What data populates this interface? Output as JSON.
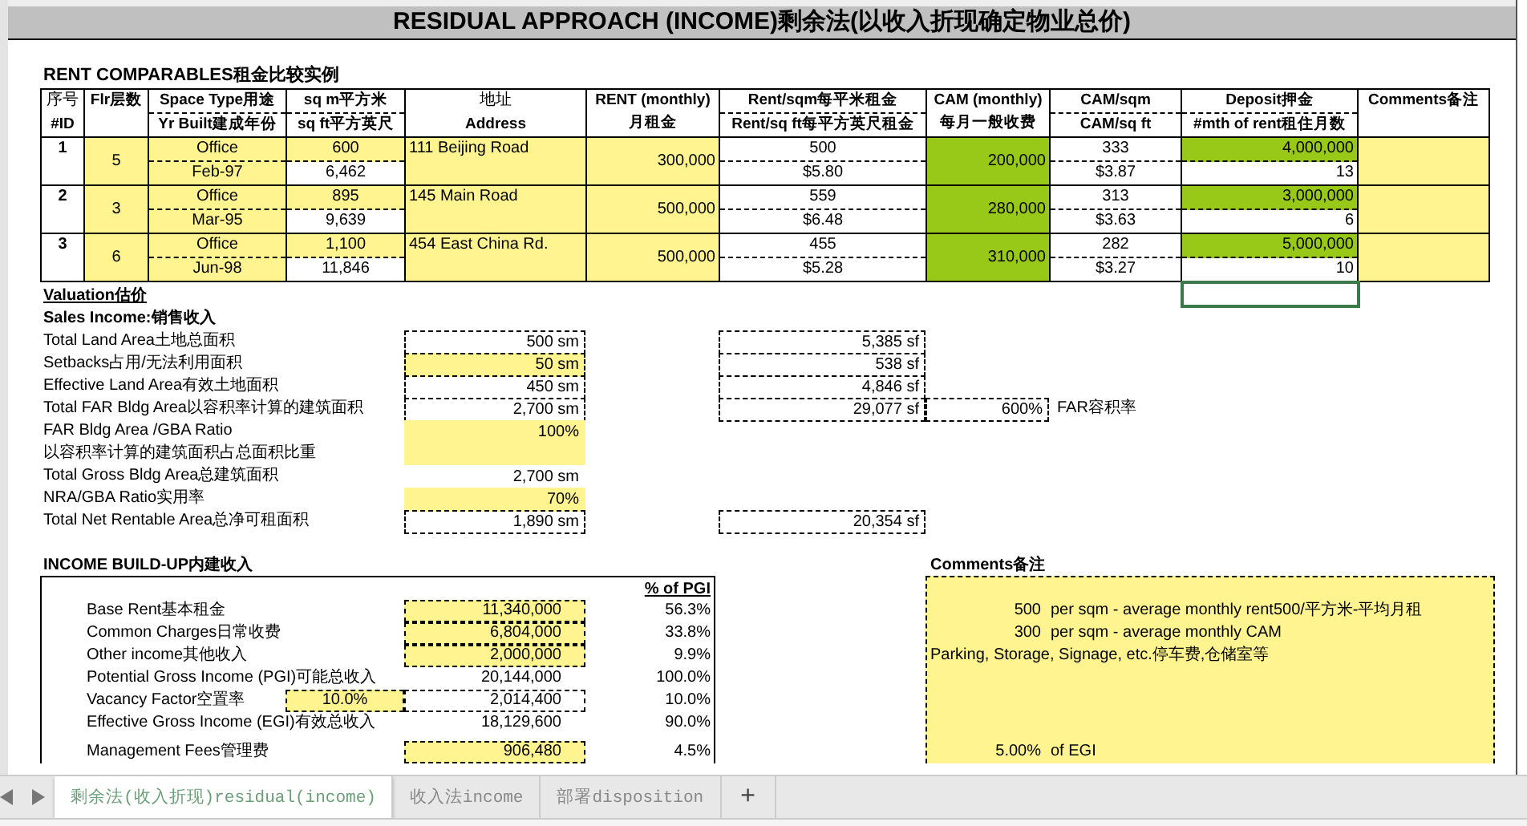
{
  "title": "RESIDUAL APPROACH (INCOME)剩余法(以收入折现确定物业总价)",
  "rent_comparables": {
    "heading": "RENT COMPARABLES租金比较实例",
    "columns": [
      {
        "kind": "stacked",
        "texts": [
          "序号",
          "#ID"
        ]
      },
      {
        "kind": "single",
        "texts": [
          "Flr层数"
        ]
      },
      {
        "kind": "split",
        "texts": [
          "Space Type用途",
          "Yr Built建成年份"
        ]
      },
      {
        "kind": "split",
        "texts": [
          "sq m平方米",
          "sq ft平方英尺"
        ]
      },
      {
        "kind": "stacked",
        "texts": [
          "地址",
          "Address"
        ]
      },
      {
        "kind": "single",
        "texts": [
          "RENT (monthly)月租金"
        ]
      },
      {
        "kind": "split",
        "texts": [
          "Rent/sqm每平米租金",
          "Rent/sq ft每平方英尺租金"
        ]
      },
      {
        "kind": "single",
        "texts": [
          "CAM (monthly)每月一般收费"
        ]
      },
      {
        "kind": "split",
        "texts": [
          "CAM/sqm",
          "CAM/sq ft"
        ]
      },
      {
        "kind": "split",
        "texts": [
          "Deposit押金",
          "#mth of rent租住月数"
        ]
      },
      {
        "kind": "single",
        "texts": [
          "Comments备注"
        ]
      }
    ],
    "rows": [
      {
        "id": "1",
        "floors": "5",
        "space_type": "Office",
        "yr_built": "Feb-97",
        "sqm": "600",
        "sqft": "6,462",
        "address": "111 Beijing Road",
        "rent": "300,000",
        "rent_sqm": "500",
        "rent_sqft": "$5.80",
        "cam": "200,000",
        "cam_sqm": "333",
        "cam_sqft": "$3.87",
        "deposit": "4,000,000",
        "deposit_months": "13"
      },
      {
        "id": "2",
        "floors": "3",
        "space_type": "Office",
        "yr_built": "Mar-95",
        "sqm": "895",
        "sqft": "9,639",
        "address": "145 Main Road",
        "rent": "500,000",
        "rent_sqm": "559",
        "rent_sqft": "$6.48",
        "cam": "280,000",
        "cam_sqm": "313",
        "cam_sqft": "$3.63",
        "deposit": "3,000,000",
        "deposit_months": "6"
      },
      {
        "id": "3",
        "floors": "6",
        "space_type": "Office",
        "yr_built": "Jun-98",
        "sqm": "1,100",
        "sqft": "11,846",
        "address": "454 East China Rd.",
        "rent": "500,000",
        "rent_sqm": "455",
        "rent_sqft": "$5.28",
        "cam": "310,000",
        "cam_sqm": "282",
        "cam_sqft": "$3.27",
        "deposit": "5,000,000",
        "deposit_months": "10"
      }
    ]
  },
  "valuation": {
    "heading": "Valuation估价",
    "subheading": "Sales Income:销售收入",
    "rows": [
      {
        "label": "Total Land Area土地总面积",
        "sm": "500 sm",
        "sm_highlight": false,
        "sm_outlined": true,
        "sf": "5,385 sf"
      },
      {
        "label": "Setbacks占用/无法利用面积",
        "sm": "50 sm",
        "sm_highlight": true,
        "sm_outlined": true,
        "sf": "538 sf"
      },
      {
        "label": "Effective Land Area有效土地面积",
        "sm": "450 sm",
        "sm_highlight": false,
        "sm_outlined": true,
        "sf": "4,846 sf"
      },
      {
        "label": "Total FAR Bldg Area以容积率计算的建筑面积",
        "sm": "2,700 sm",
        "sm_highlight": false,
        "sm_outlined": true,
        "sf": "29,077 sf",
        "far": "600%",
        "far_label": "FAR容积率"
      },
      {
        "label": "FAR Bldg Area /GBA Ratio",
        "sm": "100%",
        "sm_highlight": true,
        "sm_outlined": false
      },
      {
        "label": "以容积率计算的建筑面积占总面积比重",
        "sm_highlight": true,
        "sm_outlined": false
      },
      {
        "label": "Total Gross Bldg Area总建筑面积",
        "sm": "2,700 sm",
        "sm_highlight": false,
        "sm_outlined": false
      },
      {
        "label": "NRA/GBA Ratio实用率",
        "sm": "70%",
        "sm_highlight": true,
        "sm_outlined": false
      },
      {
        "label": "Total Net Rentable Area总净可租面积",
        "sm": "1,890 sm",
        "sm_highlight": false,
        "sm_outlined": true,
        "sf": "20,354 sf"
      }
    ]
  },
  "income": {
    "heading": "INCOME BUILD-UP内建收入",
    "pct_heading": "% of PGI",
    "comments_heading": "Comments备注",
    "rows": [
      {
        "kind": "line",
        "label": "Base Rent基本租金",
        "value": "11,340,000",
        "highlight": true,
        "outlined": true,
        "pct": "56.3%",
        "comment_amount": "500",
        "comment_text": "per sqm - average monthly rent500/平方米-平均月租"
      },
      {
        "kind": "line",
        "label": "Common Charges日常收费",
        "value": "6,804,000",
        "highlight": true,
        "outlined": true,
        "pct": "33.8%",
        "comment_amount": "300",
        "comment_text": "per sqm - average monthly CAM"
      },
      {
        "kind": "line",
        "label": "Other income其他收入",
        "value": "2,000,000",
        "highlight": true,
        "outlined": true,
        "pct": "9.9%",
        "comment_text": "Parking, Storage, Signage, etc.停车费,仓储室等"
      },
      {
        "kind": "line",
        "label": "Potential Gross Income (PGI)可能总收入",
        "value": "20,144,000",
        "highlight": false,
        "outlined": false,
        "pct": "100.0%"
      },
      {
        "kind": "line",
        "label": "Vacancy Factor空置率",
        "input": "10.0%",
        "value": "2,014,400",
        "highlight": false,
        "outlined": true,
        "pct": "10.0%"
      },
      {
        "kind": "line",
        "label": "Effective Gross Income (EGI)有效总收入",
        "value": "18,129,600",
        "highlight": false,
        "outlined": false,
        "pct": "90.0%"
      },
      {
        "kind": "blank"
      },
      {
        "kind": "line",
        "label": "Management Fees管理费",
        "value": "906,480",
        "highlight": true,
        "outlined": true,
        "pct": "4.5%",
        "comment_amount": "5.00%",
        "comment_text": "of EGI"
      }
    ]
  },
  "tabs": [
    {
      "label": "剩余法(收入折现)residual(income)",
      "selected": true
    },
    {
      "label": "收入法income",
      "selected": false
    },
    {
      "label": "部署disposition",
      "selected": false
    }
  ],
  "add_tab": "+"
}
